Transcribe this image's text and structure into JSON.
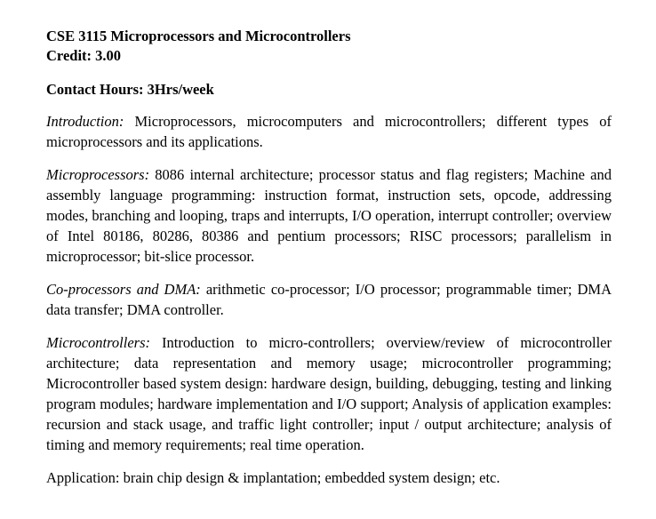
{
  "course": {
    "title": "CSE 3115 Microprocessors and Microcontrollers",
    "credit": "Credit: 3.00",
    "contact_hours": "Contact Hours: 3Hrs/week"
  },
  "sections": [
    {
      "lead": "Introduction:",
      "body": " Microprocessors, microcomputers and microcontrollers; different types of microprocessors and its applications."
    },
    {
      "lead": "Microprocessors:",
      "body": " 8086 internal architecture; processor status and flag registers; Machine and assembly language programming: instruction format, instruction sets, opcode, addressing modes, branching and looping, traps and interrupts, I/O operation, interrupt controller; overview of Intel 80186, 80286, 80386 and pentium processors; RISC processors; parallelism in microprocessor; bit-slice processor."
    },
    {
      "lead": "Co-processors and DMA:",
      "body": " arithmetic co-processor; I/O processor; programmable timer; DMA data transfer; DMA controller."
    },
    {
      "lead": "Microcontrollers:",
      "body": " Introduction to micro-controllers; overview/review of microcontroller architecture; data representation and memory usage; microcontroller programming; Microcontroller based system design: hardware design, building, debugging, testing and linking program modules; hardware implementation and I/O support; Analysis of application examples: recursion and stack usage, and traffic light controller; input / output architecture; analysis of timing and memory requirements; real time operation."
    },
    {
      "lead": "",
      "body": "Application: brain chip design & implantation; embedded system design; etc."
    }
  ]
}
